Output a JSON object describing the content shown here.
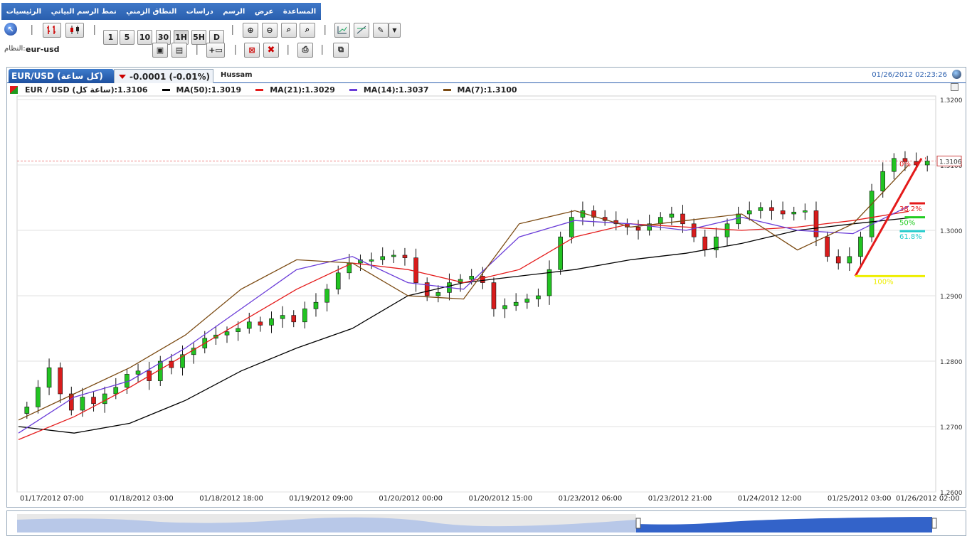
{
  "menu": [
    "الرئيسيات",
    "نمط الرسم البياني",
    "النطاق الزمني",
    "دراسات",
    "الرسم",
    "عرض",
    "المساعدة"
  ],
  "toolbar": {
    "periods": [
      "1",
      "5",
      "10",
      "30",
      "1H",
      "5H",
      "D"
    ],
    "active_period": "1H"
  },
  "symbol": {
    "label": "النظام:",
    "value": "eur-usd"
  },
  "tab": {
    "title": "EUR/USD (كل ساعة)",
    "change": "-0.0001 (-0.01%)",
    "user": "Hussam",
    "datetime": "01/26/2012 02:23:26"
  },
  "legend": [
    {
      "label": "EUR / USD (ساعة كل):1.3106",
      "color": "#1f9c1f"
    },
    {
      "label": "MA(50):1.3019",
      "color": "#000000"
    },
    {
      "label": "MA(21):1.3029",
      "color": "#e41a1a"
    },
    {
      "label": "MA(14):1.3037",
      "color": "#6a3cd8"
    },
    {
      "label": "MA(7):1.3100",
      "color": "#7b4a12"
    }
  ],
  "chart_data": {
    "type": "candlestick",
    "x_labels": [
      "01/17/2012 07:00",
      "01/18/2012 03:00",
      "01/18/2012 18:00",
      "01/19/2012 09:00",
      "01/20/2012 00:00",
      "01/20/2012 15:00",
      "01/23/2012 06:00",
      "01/23/2012 21:00",
      "01/24/2012 12:00",
      "01/25/2012 03:00",
      "01/26/2012 02:00"
    ],
    "y_ticks": [
      "1.3200",
      "1.3100",
      "1.3000",
      "1.2900",
      "1.2800",
      "1.2700",
      "1.2600"
    ],
    "ylim": [
      1.26,
      1.32
    ],
    "last_price": "1.3106",
    "close_series": [
      1.273,
      1.276,
      1.279,
      1.275,
      1.2725,
      1.2745,
      1.2735,
      1.275,
      1.276,
      1.278,
      1.2785,
      1.277,
      1.28,
      1.279,
      1.281,
      1.282,
      1.2835,
      1.284,
      1.2845,
      1.285,
      1.286,
      1.2855,
      1.2865,
      1.287,
      1.286,
      1.288,
      1.289,
      1.291,
      1.2935,
      1.295,
      1.2955,
      1.2955,
      1.296,
      1.2962,
      1.2958,
      1.292,
      1.29,
      1.2905,
      1.292,
      1.2925,
      1.293,
      1.292,
      1.288,
      1.2885,
      1.289,
      1.2895,
      1.29,
      1.294,
      1.299,
      1.302,
      1.303,
      1.302,
      1.3015,
      1.301,
      1.3005,
      1.3,
      1.301,
      1.302,
      1.3025,
      1.301,
      1.299,
      1.297,
      1.299,
      1.301,
      1.3025,
      1.303,
      1.3035,
      1.303,
      1.3025,
      1.3028,
      1.303,
      1.299,
      1.296,
      1.295,
      1.296,
      1.299,
      1.306,
      1.309,
      1.311,
      1.3105,
      1.31,
      1.3106
    ],
    "ma50": [
      1.27,
      1.269,
      1.2705,
      1.274,
      1.2785,
      1.282,
      1.285,
      1.29,
      1.292,
      1.293,
      1.294,
      1.2955,
      1.2965,
      1.298,
      1.3,
      1.301,
      1.3019
    ],
    "ma21": [
      1.268,
      1.2715,
      1.276,
      1.281,
      1.286,
      1.291,
      1.295,
      1.294,
      1.292,
      1.294,
      1.299,
      1.301,
      1.3005,
      1.3,
      1.3005,
      1.3015,
      1.3029
    ],
    "ma14": [
      1.269,
      1.2745,
      1.277,
      1.282,
      1.288,
      1.294,
      1.296,
      1.292,
      1.291,
      1.299,
      1.3015,
      1.301,
      1.3,
      1.302,
      1.3,
      1.2995,
      1.3037
    ],
    "ma7": [
      1.271,
      1.275,
      1.279,
      1.284,
      1.291,
      1.2955,
      1.295,
      1.29,
      1.2895,
      1.301,
      1.303,
      1.3005,
      1.3015,
      1.3025,
      1.297,
      1.301,
      1.31
    ],
    "fibonacci": [
      {
        "label": "0%",
        "color": "#e41a1a"
      },
      {
        "label": "38.2%",
        "color": "#e41a1a"
      },
      {
        "label": "50%",
        "color": "#22cc22"
      },
      {
        "label": "61.8%",
        "color": "#22cccc"
      },
      {
        "label": "100%",
        "color": "#eeee00"
      }
    ]
  }
}
